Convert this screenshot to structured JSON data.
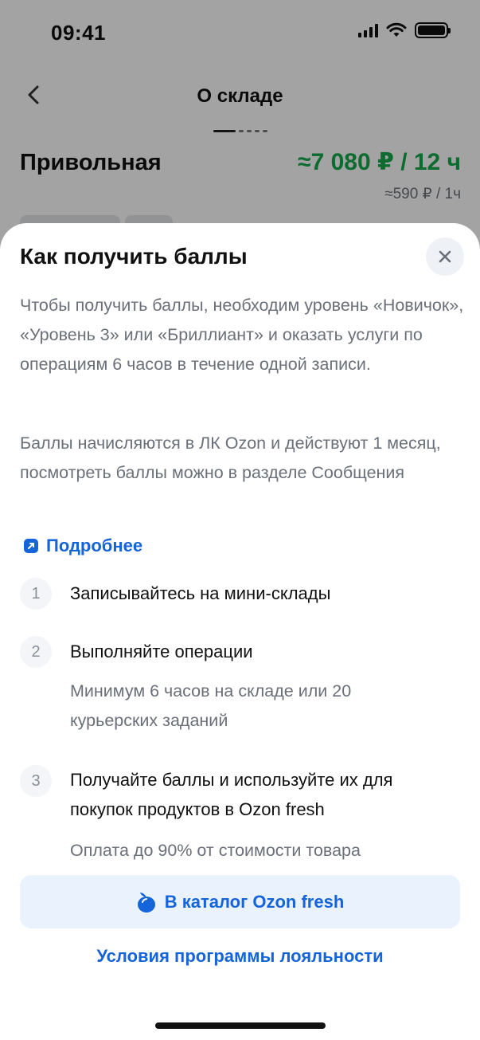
{
  "status_bar": {
    "time": "09:41"
  },
  "nav": {
    "title": "О складе"
  },
  "store": {
    "name": "Привольная",
    "price": "≈7 080 ₽ / 12 ч",
    "hourly": "≈590 ₽ / 1ч"
  },
  "sheet": {
    "title": "Как получить баллы",
    "paragraph1": "Чтобы получить баллы, необходим уровень «Новичок», «Уровень 3» или «Бриллиант» и оказать услуги по операциям 6 часов в течение одной записи.",
    "paragraph2": "Баллы начисляются в ЛК Ozon и действуют 1 месяц, посмотреть баллы можно в разделе Сообщения",
    "more_link": "Подробнее",
    "steps": [
      {
        "number": "1",
        "title": "Записывайтесь на мини-склады",
        "note": ""
      },
      {
        "number": "2",
        "title": "Выполняйте операции",
        "note": "Минимум 6 часов на складе или 20 курьерских заданий"
      },
      {
        "number": "3",
        "title": "Получайте баллы и используйте их для покупок продуктов в Ozon fresh",
        "note": "Оплата до 90% от стоимости товара"
      }
    ],
    "catalog_button": "В каталог Ozon fresh",
    "loyalty_link": "Условия программы лояльности"
  },
  "colors": {
    "accent_blue": "#1564d9",
    "price_green": "#14a84a",
    "button_bg": "#e9f2fd"
  },
  "icons": [
    "chevron-left-icon",
    "signal-icon",
    "wifi-icon",
    "battery-icon",
    "close-icon",
    "external-link-icon",
    "apple-icon"
  ]
}
